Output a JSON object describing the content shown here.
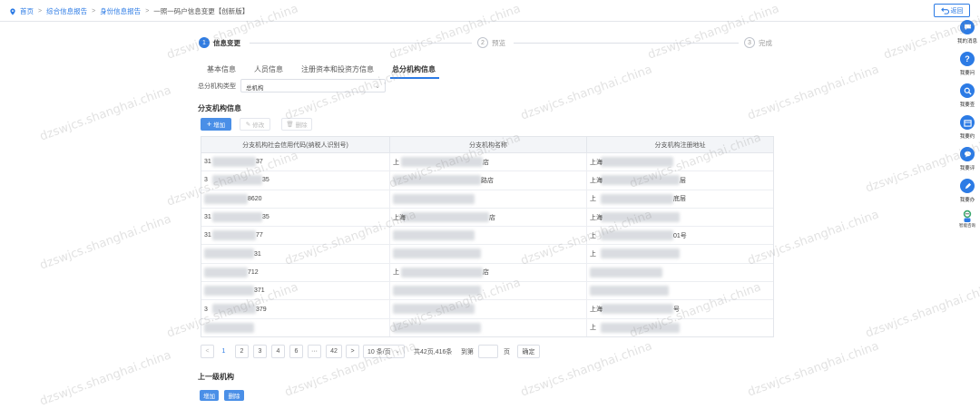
{
  "breadcrumb": {
    "items": [
      "首页",
      "综合信息报告",
      "身份信息报告",
      "一照一码户信息变更【创新版】"
    ]
  },
  "back_label": "返回",
  "steps": [
    {
      "num": "1",
      "label": "信息变更"
    },
    {
      "num": "2",
      "label": "预览"
    },
    {
      "num": "3",
      "label": "完成"
    }
  ],
  "tabs": [
    "基本信息",
    "人员信息",
    "注册资本和投资方信息",
    "总分机构信息"
  ],
  "hq_type": {
    "label": "总分机构类型",
    "value": "总机构"
  },
  "branch_section": {
    "title": "分支机构信息",
    "buttons": {
      "add": "增加",
      "edit": "修改",
      "delete": "删除"
    },
    "columns": [
      "分支机构社会信用代码(纳税人识别号)",
      "分支机构名称",
      "分支机构注册地址"
    ],
    "rows": [
      [
        {
          "pre": "31",
          "post": "37"
        },
        {
          "pre": "上",
          "post": "店"
        },
        {
          "pre": "上海",
          "post": ""
        }
      ],
      [
        {
          "pre": "3",
          "post": "35"
        },
        {
          "pre": "",
          "post": "路店"
        },
        {
          "pre": "上海",
          "post": "层"
        }
      ],
      [
        {
          "pre": "",
          "post": "8620"
        },
        {
          "pre": "",
          "post": ""
        },
        {
          "pre": "上",
          "post": "底层"
        }
      ],
      [
        {
          "pre": "31",
          "post": "35"
        },
        {
          "pre": "上海",
          "post": "店"
        },
        {
          "pre": "上海",
          "post": ""
        }
      ],
      [
        {
          "pre": "31",
          "post": "77"
        },
        {
          "pre": "",
          "post": ""
        },
        {
          "pre": "上",
          "post": "01号"
        }
      ],
      [
        {
          "pre": "",
          "post": "31"
        },
        {
          "pre": "",
          "post": ""
        },
        {
          "pre": "上",
          "post": ""
        }
      ],
      [
        {
          "pre": "",
          "post": "712"
        },
        {
          "pre": "上",
          "post": "店"
        },
        {
          "pre": "",
          "post": ""
        }
      ],
      [
        {
          "pre": "",
          "post": "371"
        },
        {
          "pre": "",
          "post": ""
        },
        {
          "pre": "",
          "post": ""
        }
      ],
      [
        {
          "pre": "3",
          "post": "379"
        },
        {
          "pre": "",
          "post": ""
        },
        {
          "pre": "上海",
          "post": "号"
        }
      ],
      [
        {
          "pre": "",
          "post": ""
        },
        {
          "pre": "",
          "post": ""
        },
        {
          "pre": "上",
          "post": ""
        }
      ]
    ]
  },
  "pagination": {
    "prev": "<",
    "pages": [
      "1",
      "2",
      "3",
      "4",
      "6",
      "···",
      "42"
    ],
    "next": ">",
    "page_size": "10 条/页",
    "summary": "共42页,416条",
    "goto_label": "到第",
    "goto_value": "",
    "page_unit": "页",
    "confirm": "确定"
  },
  "parent_section": {
    "title": "上一级机构",
    "buttons": {
      "add": "增加",
      "delete": "删除"
    }
  },
  "sidebar": [
    {
      "icon": "chat-icon",
      "label": "我的消息"
    },
    {
      "icon": "question-icon",
      "label": "我要问"
    },
    {
      "icon": "search-icon",
      "label": "我要查"
    },
    {
      "icon": "calendar-icon",
      "label": "我要约"
    },
    {
      "icon": "comment-icon",
      "label": "我要评"
    },
    {
      "icon": "pen-icon",
      "label": "我要办"
    },
    {
      "icon": "robot-icon",
      "label": "智能咨询"
    }
  ],
  "watermark": "dzswjcs.shanghai.china",
  "colors": {
    "accent": "#2c7be5",
    "button": "#4a8fe7"
  }
}
